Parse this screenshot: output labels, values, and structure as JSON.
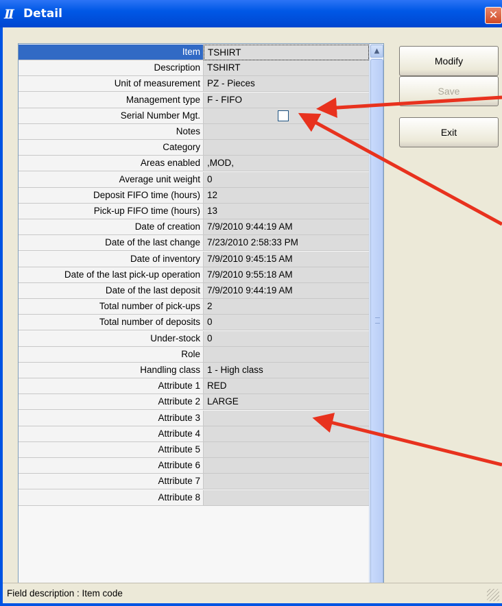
{
  "window": {
    "title": "Detail",
    "close_label": "✕"
  },
  "rows": [
    {
      "label": "Item",
      "value": "TSHIRT"
    },
    {
      "label": "Description",
      "value": "TSHIRT"
    },
    {
      "label": "Unit of measurement",
      "value": "PZ - Pieces"
    },
    {
      "label": "Management type",
      "value": "F - FIFO"
    },
    {
      "label": "Serial Number Mgt.",
      "value": ""
    },
    {
      "label": "Notes",
      "value": ""
    },
    {
      "label": "Category",
      "value": ""
    },
    {
      "label": "Areas enabled",
      "value": ",MOD,"
    },
    {
      "label": "Average unit weight",
      "value": "0"
    },
    {
      "label": "Deposit FIFO time (hours)",
      "value": "12"
    },
    {
      "label": "Pick-up FIFO time (hours)",
      "value": "13"
    },
    {
      "label": "Date of creation",
      "value": "7/9/2010 9:44:19 AM"
    },
    {
      "label": "Date of the last change",
      "value": "7/23/2010 2:58:33 PM"
    },
    {
      "label": "Date of inventory",
      "value": "7/9/2010 9:45:15 AM"
    },
    {
      "label": "Date of the last pick-up operation",
      "value": "7/9/2010 9:55:18 AM"
    },
    {
      "label": "Date of the last deposit",
      "value": "7/9/2010 9:44:19 AM"
    },
    {
      "label": "Total number of pick-ups",
      "value": "2"
    },
    {
      "label": "Total number of deposits",
      "value": "0"
    },
    {
      "label": "Under-stock",
      "value": "0"
    },
    {
      "label": "Role",
      "value": ""
    },
    {
      "label": "Handling class",
      "value": "1 - High class"
    },
    {
      "label": "Attribute 1",
      "value": "RED"
    },
    {
      "label": "Attribute 2",
      "value": "LARGE"
    },
    {
      "label": "Attribute 3",
      "value": ""
    },
    {
      "label": "Attribute 4",
      "value": ""
    },
    {
      "label": "Attribute 5",
      "value": ""
    },
    {
      "label": "Attribute 6",
      "value": ""
    },
    {
      "label": "Attribute 7",
      "value": ""
    },
    {
      "label": "Attribute 8",
      "value": ""
    }
  ],
  "serial_number_checked": false,
  "buttons": {
    "modify": "Modify",
    "save": "Save",
    "exit": "Exit"
  },
  "status": {
    "text": "Field description : Item code"
  },
  "colors": {
    "title_bar": "#0058e6",
    "selection": "#316ac5",
    "annotation_arrow": "#e8321e"
  },
  "icons": {
    "app": "app-logo-icon",
    "close": "close-icon",
    "scroll_up": "chevron-up-icon",
    "scroll_down": "chevron-down-icon"
  }
}
